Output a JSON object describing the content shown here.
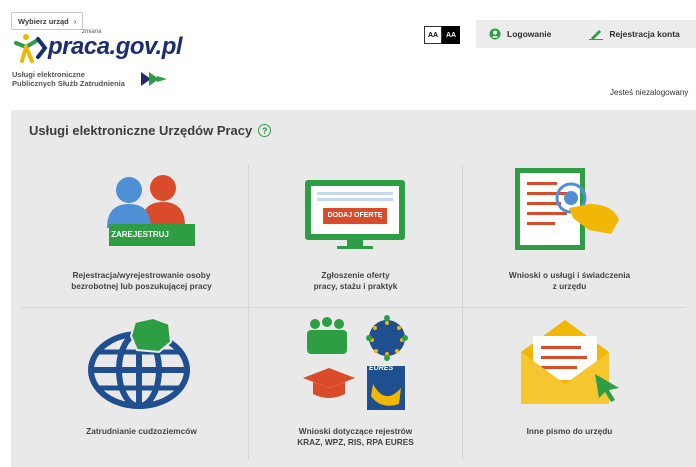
{
  "header": {
    "office_button": "Wybierz urząd",
    "logo_text": "praca.gov.pl",
    "logo_sup": "zmiana",
    "tagline_line1": "Usługi elektroniczne",
    "tagline_line2": "Publicznych Służb Zatrudnienia",
    "contrast_normal": "AA",
    "contrast_high": "AA",
    "login_label": "Logowanie",
    "register_label": "Rejestracja konta",
    "user_status": "Jesteś niezalogowany"
  },
  "main": {
    "title": "Usługi elektroniczne Urzędów Pracy",
    "tiles": [
      {
        "label_line1": "Rejestracja/wyrejestrowanie osoby",
        "label_line2": "bezrobotnej lub poszukującej pracy",
        "badge": "ZAREJESTRUJ"
      },
      {
        "label_line1": "Zgłoszenie oferty",
        "label_line2": "pracy, stażu i praktyk",
        "badge": "DODAJ OFERTĘ"
      },
      {
        "label_line1": "Wnioski o usługi i świadczenia",
        "label_line2": "z urzędu"
      },
      {
        "label_line1": "Zatrudnianie cudzoziemców",
        "label_line2": ""
      },
      {
        "label_line1": "Wnioski dotyczące rejestrów",
        "label_line2": "KRAZ, WPZ, RIS, RPA EURES",
        "badge": "EURES"
      },
      {
        "label_line1": "Inne pismo do urzędu",
        "label_line2": ""
      }
    ]
  },
  "colors": {
    "green": "#2e9e44",
    "navy": "#1d2f6b",
    "blue": "#2b62a8",
    "red": "#d94b2b",
    "yellow": "#f2b705"
  }
}
